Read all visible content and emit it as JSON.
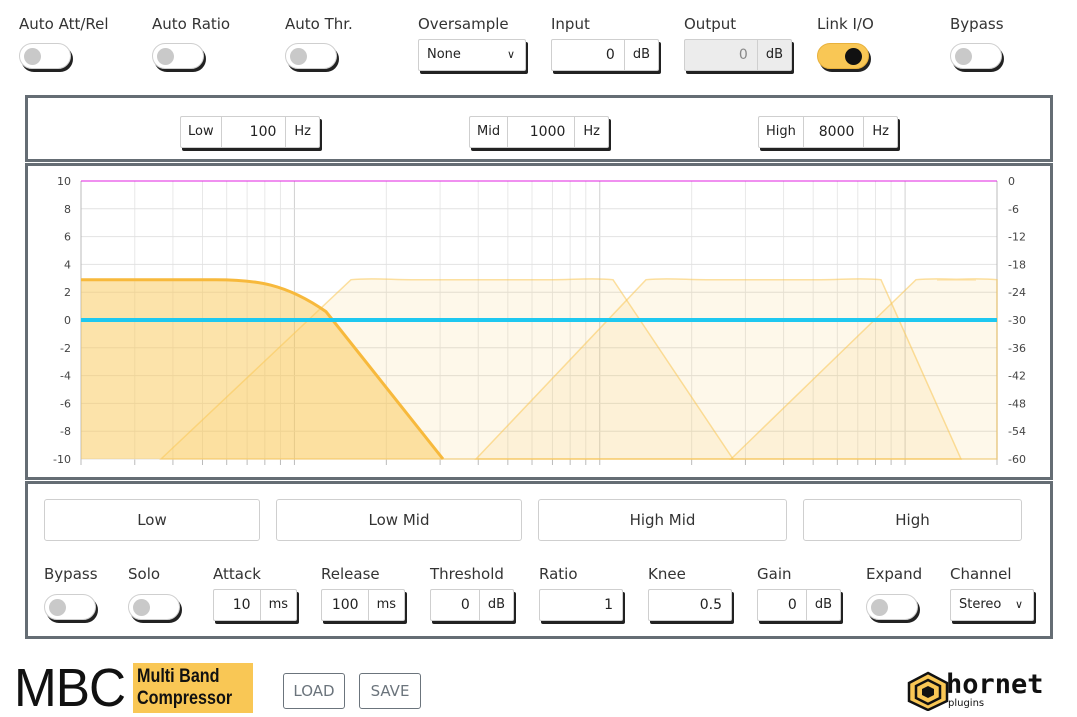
{
  "top": {
    "auto_att_rel": {
      "label": "Auto Att/Rel",
      "on": false
    },
    "auto_ratio": {
      "label": "Auto Ratio",
      "on": false
    },
    "auto_thr": {
      "label": "Auto Thr.",
      "on": false
    },
    "oversample": {
      "label": "Oversample",
      "value": "None"
    },
    "input": {
      "label": "Input",
      "value": "0",
      "unit": "dB"
    },
    "output": {
      "label": "Output",
      "value": "0",
      "unit": "dB"
    },
    "link_io": {
      "label": "Link I/O",
      "on": true
    },
    "bypass": {
      "label": "Bypass",
      "on": false
    }
  },
  "crossovers": [
    {
      "label": "Low",
      "value": "100",
      "unit": "Hz"
    },
    {
      "label": "Mid",
      "value": "1000",
      "unit": "Hz"
    },
    {
      "label": "High",
      "value": "8000",
      "unit": "Hz"
    }
  ],
  "graph": {
    "left_ticks": [
      "10",
      "8",
      "6",
      "4",
      "2",
      "0",
      "-2",
      "-4",
      "-6",
      "-8",
      "-10"
    ],
    "right_ticks": [
      "0",
      "-6",
      "-12",
      "-18",
      "-24",
      "-30",
      "-36",
      "-42",
      "-48",
      "-54",
      "-60"
    ],
    "colors": {
      "band": "#f9c755",
      "zero_line": "#1ec8f0",
      "top_line": "#e020e0"
    }
  },
  "bands": [
    {
      "label": "Low",
      "active": true
    },
    {
      "label": "Low Mid",
      "active": false
    },
    {
      "label": "High Mid",
      "active": false
    },
    {
      "label": "High",
      "active": false
    }
  ],
  "controls": {
    "bypass": {
      "label": "Bypass",
      "on": false
    },
    "solo": {
      "label": "Solo",
      "on": false
    },
    "attack": {
      "label": "Attack",
      "value": "10",
      "unit": "ms"
    },
    "release": {
      "label": "Release",
      "value": "100",
      "unit": "ms"
    },
    "threshold": {
      "label": "Threshold",
      "value": "0",
      "unit": "dB"
    },
    "ratio": {
      "label": "Ratio",
      "value": "1"
    },
    "knee": {
      "label": "Knee",
      "value": "0.5"
    },
    "gain": {
      "label": "Gain",
      "value": "0",
      "unit": "dB"
    },
    "expand": {
      "label": "Expand",
      "on": false
    },
    "channel": {
      "label": "Channel",
      "value": "Stereo"
    }
  },
  "footer": {
    "logo_main": "MBC",
    "logo_line1": "Multi Band",
    "logo_line2": "Compressor",
    "load_label": "LOAD",
    "save_label": "SAVE",
    "brand": "hornet",
    "brand_sub": "plugins"
  }
}
